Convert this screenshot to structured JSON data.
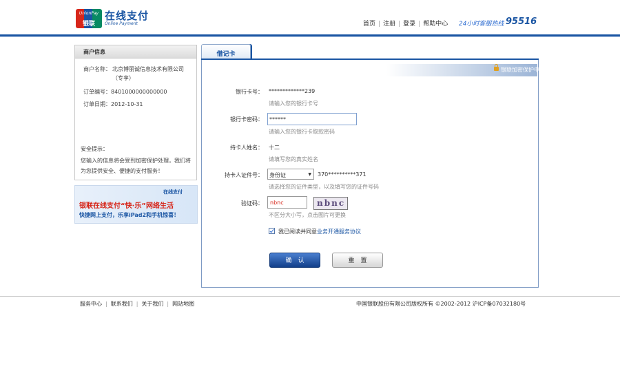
{
  "header": {
    "logo_en": "UnionPay",
    "logo_cn": "银联",
    "brand_cn": "在线支付",
    "brand_en": "Online Payment",
    "nav": [
      "首页",
      "注册",
      "登录",
      "帮助中心"
    ],
    "hotline_label": "24小时客服热线",
    "hotline_number": "95516"
  },
  "merchant": {
    "title": "商户信息",
    "name_label": "商户名称：",
    "name_value": "北京博丽诚信息技术有限公司（专享）",
    "order_label": "订单编号：",
    "order_value": "8401000000000000",
    "date_label": "订单日期：",
    "date_value": "2012-10-31",
    "security_title": "安全提示：",
    "security_text": "您输入的信息将会受到加密保护处理，我们将为您提供安全、便捷的支付服务！"
  },
  "banner": {
    "logo": "在线支付",
    "title": "银联在线支付“快·乐”网络生活",
    "subtitle": "快捷网上支付，乐享iPad2和手机惊喜！"
  },
  "tab": {
    "label": "借记卡"
  },
  "secure": {
    "text": "银联加密保护中"
  },
  "form": {
    "card_label": "银行卡号：",
    "card_value": "*************239",
    "card_hint": "请输入您的银行卡号",
    "pwd_label": "银行卡密码：",
    "pwd_value": "******",
    "pwd_hint": "请输入您的银行卡取款密码",
    "name_label": "持卡人姓名：",
    "name_value": "十二",
    "name_hint": "请填写您的真实姓名",
    "id_label": "持卡人证件号：",
    "id_type": "身份证",
    "id_value": "370**********371",
    "id_hint": "请选择您的证件类型，以及填写您的证件号码",
    "captcha_label": "验证码：",
    "captcha_value": "nbnc",
    "captcha_image_text": "nbnc",
    "captcha_hint": "不区分大小写，点击图片可更换",
    "agree_text": "我已阅读并同意",
    "agree_link": "业务开通服务协议",
    "confirm_label": "确　认",
    "reset_label": "重　置"
  },
  "footer": {
    "links": [
      "服务中心",
      "联系我们",
      "关于我们",
      "网站地图"
    ],
    "copyright": "中国银联股份有限公司版权所有 ©2002-2012  沪ICP备07032180号"
  }
}
